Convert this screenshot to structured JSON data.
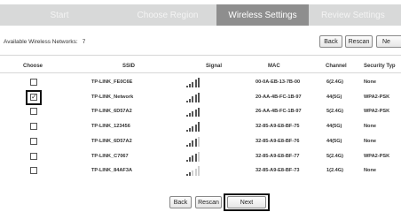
{
  "wizard": {
    "steps": [
      "Start",
      "Choose Region",
      "Wireless Settings",
      "Review Settings"
    ],
    "active_index": 2
  },
  "available": {
    "label": "Available Wireless Networks:",
    "count": "7"
  },
  "buttons": {
    "back": "Back",
    "rescan": "Rescan",
    "next": "Next",
    "next_top": "Ne"
  },
  "table": {
    "headers": [
      "Choose",
      "SSID",
      "Signal",
      "MAC",
      "Channel",
      "Security Typ"
    ],
    "rows": [
      {
        "ssid": "TP-LINK_FE0C6E",
        "mac": "00-0A-EB-13-7B-00",
        "channel": "6(2.4G)",
        "security": "None",
        "checked": false,
        "signal_bars": 5
      },
      {
        "ssid": "TP-LINK_Network",
        "mac": "20-AA-4B-FC-1B-97",
        "channel": "44(5G)",
        "security": "WPA2-PSK",
        "checked": true,
        "signal_bars": 5
      },
      {
        "ssid": "TP-LINK_6D57A2",
        "mac": "26-AA-4B-FC-1B-97",
        "channel": "5(2.4G)",
        "security": "WPA2-PSK",
        "checked": false,
        "signal_bars": 5
      },
      {
        "ssid": "TP-LINK_123456",
        "mac": "32-85-A9-E8-BF-75",
        "channel": "44(5G)",
        "security": "None",
        "checked": false,
        "signal_bars": 5
      },
      {
        "ssid": "TP-LINK_6D57A2",
        "mac": "32-85-A9-E8-BF-76",
        "channel": "44(5G)",
        "security": "None",
        "checked": false,
        "signal_bars": 4
      },
      {
        "ssid": "TP-LINK_C7067",
        "mac": "32-85-A9-E8-BF-77",
        "channel": "5(2.4G)",
        "security": "WPA2-PSK",
        "checked": false,
        "signal_bars": 4
      },
      {
        "ssid": "TP-LINK_84AF3A",
        "mac": "32-85-A9-E8-BF-73",
        "channel": "1(2.4G)",
        "security": "None",
        "checked": false,
        "signal_bars": 2
      }
    ]
  },
  "colors": {
    "wizard_bg": "#d8d9d9",
    "wizard_active": "#8e8e8e",
    "highlight": "#111111"
  }
}
